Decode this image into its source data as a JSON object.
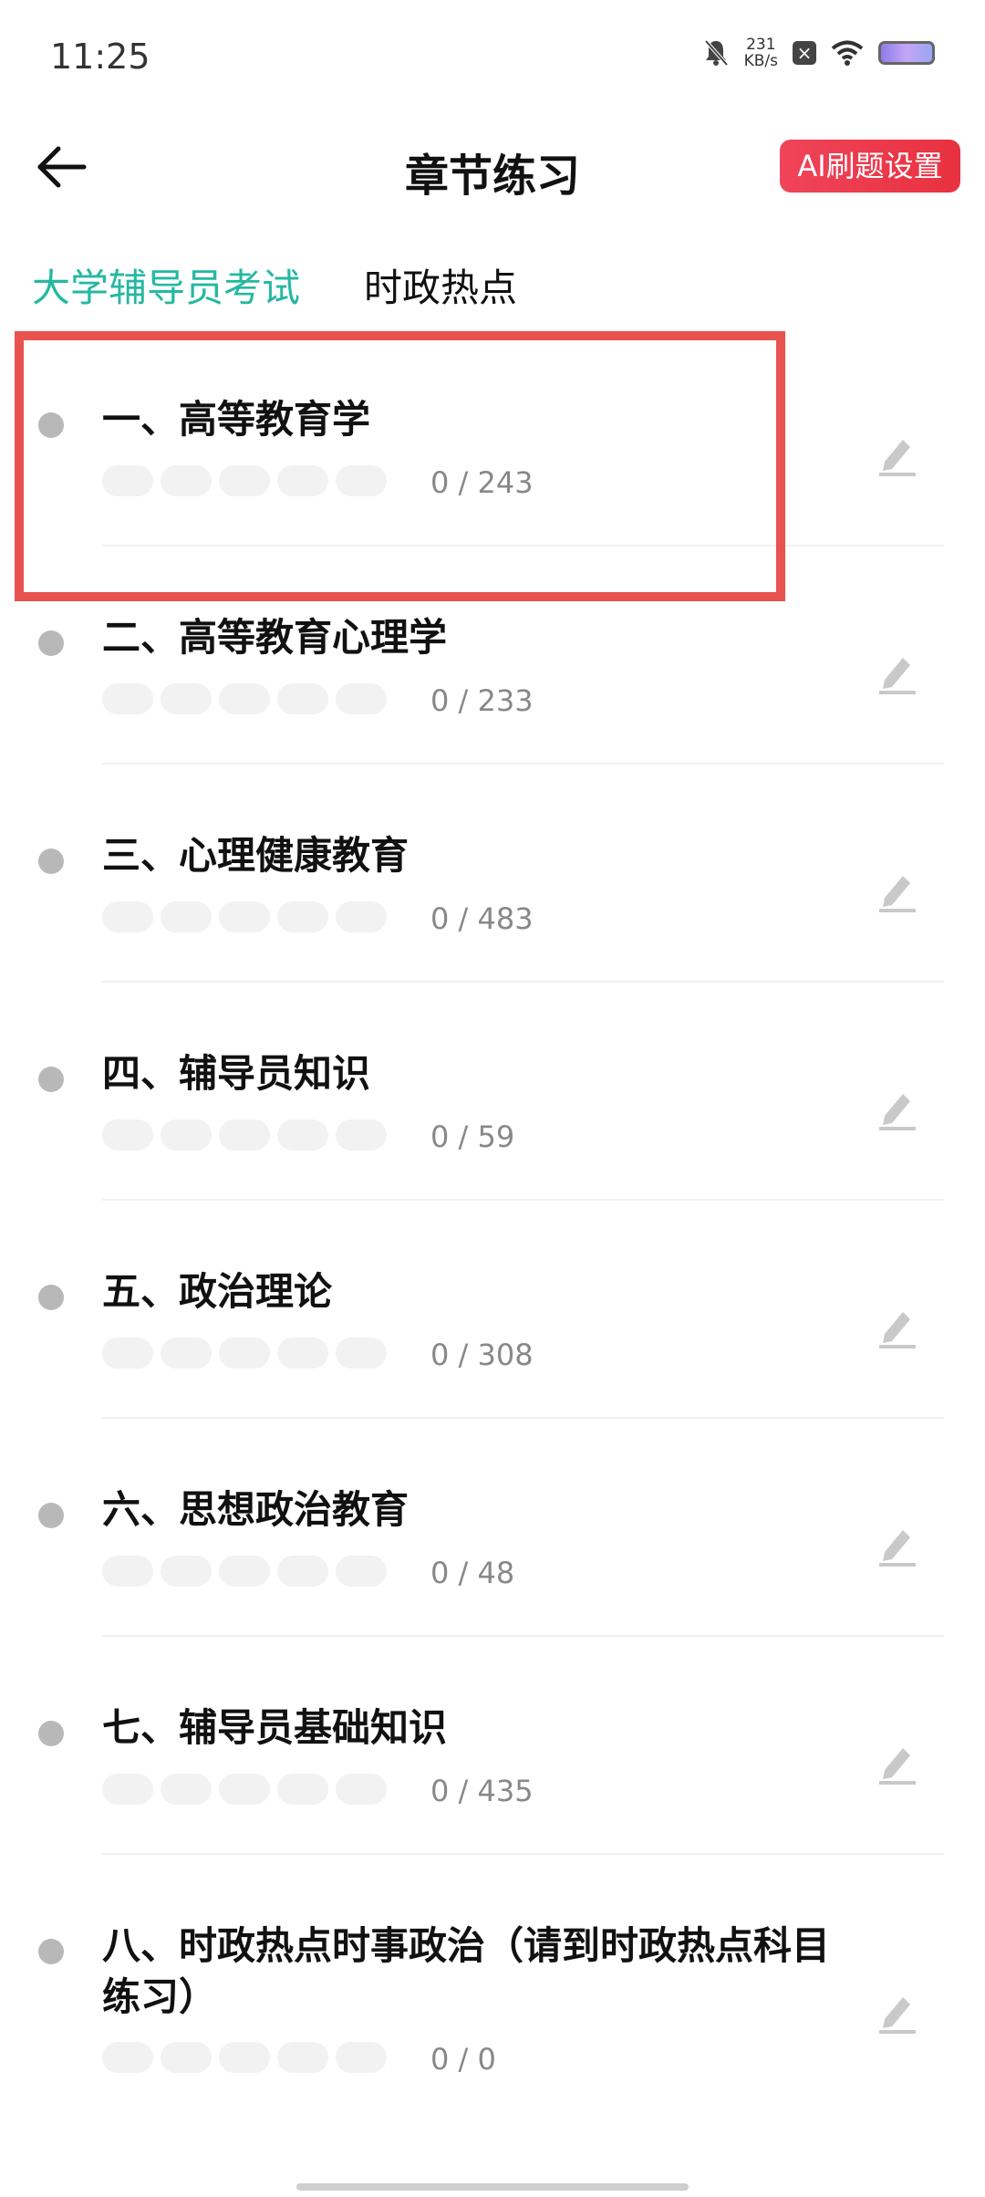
{
  "status_bar": {
    "time": "11:25",
    "speed_value": "231",
    "speed_unit": "KB/s"
  },
  "header": {
    "title": "章节练习",
    "ai_button": "AI刷题设置"
  },
  "tabs": [
    {
      "label": "大学辅导员考试"
    },
    {
      "label": "时政热点"
    }
  ],
  "chapters": [
    {
      "title": "一、高等教育学",
      "count": "0 / 243"
    },
    {
      "title": "二、高等教育心理学",
      "count": "0 / 233"
    },
    {
      "title": "三、心理健康教育",
      "count": "0 / 483"
    },
    {
      "title": "四、辅导员知识",
      "count": "0 / 59"
    },
    {
      "title": "五、政治理论",
      "count": "0 / 308"
    },
    {
      "title": "六、思想政治教育",
      "count": "0 / 48"
    },
    {
      "title": "七、辅导员基础知识",
      "count": "0 / 435"
    },
    {
      "title": "八、时政热点时事政治（请到时政热点科目练习）",
      "count": "0 / 0"
    }
  ],
  "colors": {
    "accent": "#25b8a1",
    "ai_button": "#e8313f",
    "highlight": "#e8524f"
  },
  "icons": [
    "back-arrow-icon",
    "edit-pencil-icon",
    "mute-bell-icon",
    "wifi-icon",
    "battery-icon"
  ]
}
